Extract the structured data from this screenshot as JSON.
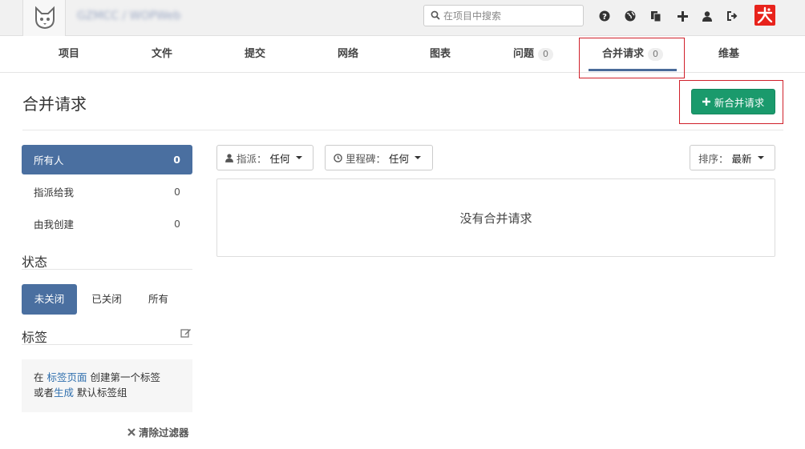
{
  "header": {
    "project_path": "GZMCC / WOPWeb",
    "search": {
      "placeholder": "在项目中搜索",
      "value": ""
    },
    "icons": [
      "help-icon",
      "globe-icon",
      "copy-icon",
      "plus-icon",
      "user-icon",
      "sign-out-icon"
    ]
  },
  "nav": {
    "tabs": [
      {
        "label": "项目"
      },
      {
        "label": "文件"
      },
      {
        "label": "提交"
      },
      {
        "label": "网络"
      },
      {
        "label": "图表"
      },
      {
        "label": "问题",
        "count": "0"
      },
      {
        "label": "合并请求",
        "count": "0",
        "active": true
      },
      {
        "label": "维基"
      }
    ]
  },
  "page": {
    "title": "合并请求",
    "new_button": "新合并请求"
  },
  "sidebar": {
    "scope_items": [
      {
        "label": "所有人",
        "count": "0",
        "active": true
      },
      {
        "label": "指派给我",
        "count": "0"
      },
      {
        "label": "由我创建",
        "count": "0"
      }
    ],
    "state_title": "状态",
    "states": [
      {
        "label": "未关闭",
        "active": true
      },
      {
        "label": "已关闭"
      },
      {
        "label": "所有"
      }
    ],
    "labels_title": "标签",
    "labels_hint": {
      "prefix": "在",
      "link1": "标签页面",
      "middle": "创建第一个标签",
      "line2_prefix": "或者",
      "link2": "生成",
      "suffix": "默认标签组"
    },
    "clear_filters": "清除过滤器"
  },
  "filters": {
    "assignee": {
      "label": "指派：",
      "value": "任何"
    },
    "milestone": {
      "label": "里程碑：",
      "value": "任何"
    },
    "sort": {
      "label": "排序：",
      "value": "最新"
    }
  },
  "empty_state": "没有合并请求",
  "colors": {
    "accent": "#4a6fa0",
    "new_button": "#1a9a6c",
    "highlight": "#d0202a",
    "brand": "#e8231c"
  }
}
